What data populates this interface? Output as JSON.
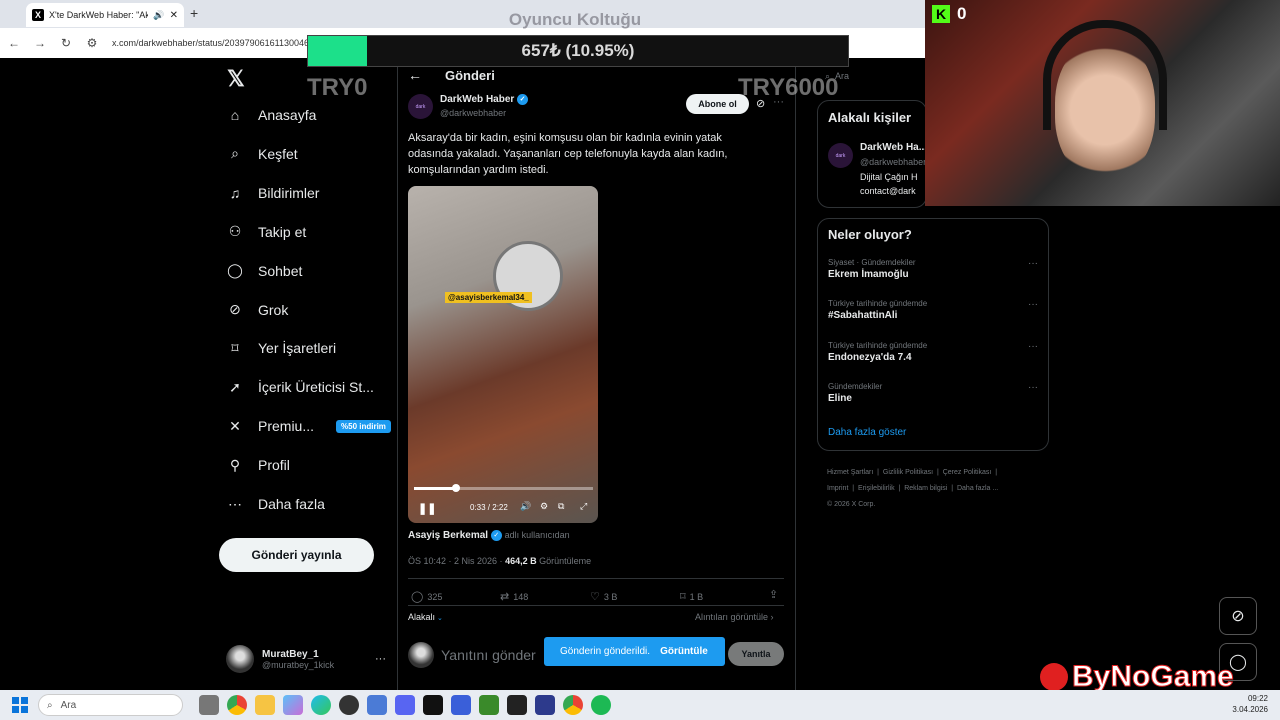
{
  "browser": {
    "tab_title": "X'te DarkWeb Haber: \"Aksa",
    "new_tab_label": "+",
    "url": "x.com/darkwebhaber/status/20397906161130046"
  },
  "overlay": {
    "stream_title": "Oyuncu Koltuğu",
    "progress_text": "657₺ (10.95%)",
    "progress_value": 0.1095,
    "left_goal": "TRY0",
    "right_goal": "TRY6000",
    "kick_count": "0",
    "watermark": "ByNoGame"
  },
  "sidebar": {
    "items": [
      {
        "label": "Anasayfa",
        "icon": "home-icon"
      },
      {
        "label": "Keşfet",
        "icon": "search-icon"
      },
      {
        "label": "Bildirimler",
        "icon": "bell-icon"
      },
      {
        "label": "Takip et",
        "icon": "add-user-icon"
      },
      {
        "label": "Sohbet",
        "icon": "chat-icon"
      },
      {
        "label": "Grok",
        "icon": "grok-icon"
      },
      {
        "label": "Yer İşaretleri",
        "icon": "bookmark-icon"
      },
      {
        "label": "İçerik Üreticisi St...",
        "icon": "rocket-icon"
      },
      {
        "label": "Premiu...",
        "icon": "x-logo-icon",
        "badge": "%50 indirim"
      },
      {
        "label": "Profil",
        "icon": "profile-icon"
      },
      {
        "label": "Daha fazla",
        "icon": "more-circle-icon"
      }
    ],
    "post_button": "Gönderi yayınla",
    "account": {
      "name": "MuratBey_1",
      "handle": "@muratbey_1kick",
      "more": "···"
    }
  },
  "main": {
    "back_icon": "←",
    "header": "Gönderi",
    "author": {
      "name": "DarkWeb Haber",
      "handle": "@darkwebhaber"
    },
    "subscribe": "Abone ol",
    "tweet_text": "Aksaray'da bir kadın, eşini komşusu olan bir kadınla evinin yatak odasında yakaladı. Yaşananları cep telefonuyla kayda alan kadın, komşularından yardım istedi.",
    "video": {
      "caption": "@asayisberkemal34_",
      "time": "0:33 / 2:22",
      "progress": 0.232
    },
    "source_name": "Asayiş Berkemal",
    "source_suffix": "adlı kullanıcıdan",
    "meta": "ÖS 10:42 · 2 Nis 2026 · ",
    "views": "464,2 B",
    "views_label": "Görüntüleme",
    "actions": {
      "replies": "325",
      "retweets": "148",
      "likes": "3 B",
      "bookmarks": "1 B"
    },
    "relevant": "Alakalı",
    "quotes": "Alıntıları görüntüle ›",
    "reply_placeholder": "Yanıtını gönder",
    "toast": {
      "text": "Gönderin gönderildi.",
      "action": "Görüntüle"
    },
    "reply_button": "Yanıtla"
  },
  "right": {
    "search_placeholder": "Ara",
    "relevant_people_title": "Alakalı kişiler",
    "person": {
      "name": "DarkWeb Ha...",
      "handle": "@darkwebhaber",
      "bio1": "Dijital Çağın H",
      "bio2": "contact@dark"
    },
    "trends_title": "Neler oluyor?",
    "trends": [
      {
        "category": "Siyaset · Gündemdekiler",
        "name": "Ekrem İmamoğlu"
      },
      {
        "category": "Türkiye tarihinde gündemde",
        "name": "#SabahattinAli"
      },
      {
        "category": "Türkiye tarihinde gündemde",
        "name": "Endonezya'da 7.4"
      },
      {
        "category": "Gündemdekiler",
        "name": "Eline"
      }
    ],
    "show_more": "Daha fazla göster",
    "footer": [
      "Hizmet Şartları",
      "Gizlilik Politikası",
      "Çerez Politikası",
      "Imprint",
      "Erişilebilirlik",
      "Reklam bilgisi",
      "Daha fazla ...",
      "© 2026 X Corp."
    ]
  },
  "taskbar": {
    "search_placeholder": "Ara",
    "time": "09:22",
    "date": "3.04.2026"
  }
}
